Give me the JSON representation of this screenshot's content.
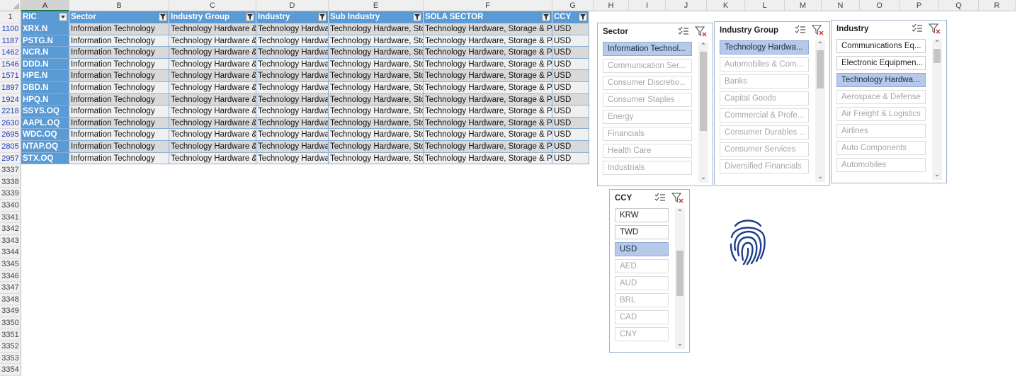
{
  "columns": [
    "A",
    "B",
    "C",
    "D",
    "E",
    "F",
    "G",
    "H",
    "I",
    "J",
    "K",
    "L",
    "M",
    "N",
    "O",
    "P",
    "Q",
    "R"
  ],
  "selected_column": "A",
  "table": {
    "headers": [
      "RIC",
      "Sector",
      "Industry Group",
      "Industry",
      "Sub Industry",
      "SOLA SECTOR",
      "CCY"
    ],
    "rows": [
      {
        "row": "1100",
        "ric": "XRX.N"
      },
      {
        "row": "1187",
        "ric": "PSTG.N"
      },
      {
        "row": "1462",
        "ric": "NCR.N"
      },
      {
        "row": "1546",
        "ric": "DDD.N"
      },
      {
        "row": "1571",
        "ric": "HPE.N"
      },
      {
        "row": "1897",
        "ric": "DBD.N"
      },
      {
        "row": "1924",
        "ric": "HPQ.N"
      },
      {
        "row": "2218",
        "ric": "SSYS.OQ"
      },
      {
        "row": "2630",
        "ric": "AAPL.OQ"
      },
      {
        "row": "2695",
        "ric": "WDC.OQ"
      },
      {
        "row": "2805",
        "ric": "NTAP.OQ"
      },
      {
        "row": "2957",
        "ric": "STX.OQ"
      }
    ],
    "values": {
      "sector": "Information Technology",
      "industry_group": "Technology Hardware &",
      "industry": "Technology Hardwa",
      "sub_industry": "Technology Hardware, Sto",
      "sola_sector": "Technology Hardware, Storage & P",
      "ccy": "USD"
    }
  },
  "empty_rows": [
    "3337",
    "3338",
    "3339",
    "3340",
    "3341",
    "3342",
    "3343",
    "3344",
    "3345",
    "3346",
    "3347",
    "3348",
    "3349",
    "3350",
    "3351",
    "3352",
    "3353",
    "3354"
  ],
  "header_row_number": "1",
  "slicers": {
    "sector": {
      "title": "Sector",
      "items": [
        "Information Technol...",
        "Communication Ser...",
        "Consumer Discretio...",
        "Consumer Staples",
        "Energy",
        "Financials",
        "Health Care",
        "Industrials"
      ]
    },
    "industry_group": {
      "title": "Industry Group",
      "items": [
        "Technology Hardwa...",
        "Automobiles & Com...",
        "Banks",
        "Capital Goods",
        "Commercial  & Profe...",
        "Consumer Durables ...",
        "Consumer Services",
        "Diversified Financials"
      ]
    },
    "industry": {
      "title": "Industry",
      "items": [
        "Communications Eq...",
        "Electronic Equipmen...",
        "Technology Hardwa...",
        "Aerospace & Defense",
        "Air Freight & Logistics",
        "Airlines",
        "Auto Components",
        "Automobiles"
      ]
    },
    "ccy": {
      "title": "CCY",
      "items": [
        "KRW",
        "TWD",
        "USD",
        "AED",
        "AUD",
        "BRL",
        "CAD",
        "CNY"
      ]
    }
  },
  "colors": {
    "table_header": "#5b9bd5",
    "selected_item": "#b7c9e8",
    "fingerprint": "#1f3d8a"
  },
  "icons": [
    "multi-select-icon",
    "clear-filter-icon",
    "filter-dropdown-icon",
    "fingerprint-icon"
  ]
}
